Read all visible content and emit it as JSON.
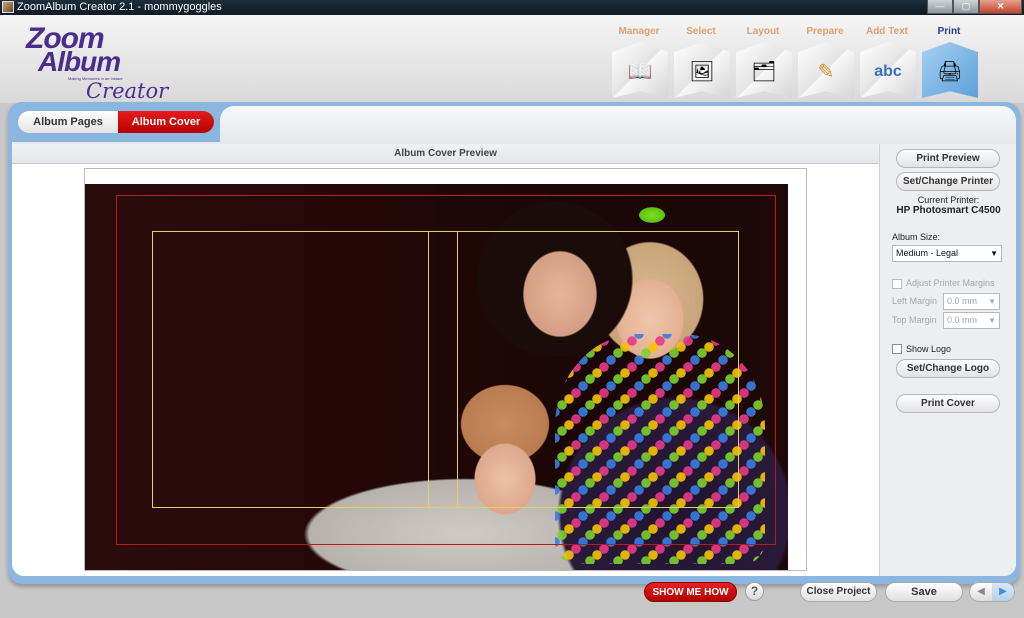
{
  "window": {
    "title": "ZoomAlbum Creator 2.1 - mommygoggles",
    "controls": {
      "minimize": "—",
      "maximize": "▢",
      "close": "✕"
    }
  },
  "logo": {
    "line1": "Zoom",
    "line2": "Album",
    "tagline": "Making Memories in an Instant",
    "line3": "Creator"
  },
  "steps": [
    {
      "label": "Manager",
      "icon": "photo-album-icon",
      "glyph": "📖"
    },
    {
      "label": "Select",
      "icon": "photos-icon",
      "glyph": "🖼"
    },
    {
      "label": "Layout",
      "icon": "layout-icon",
      "glyph": "🗂"
    },
    {
      "label": "Prepare",
      "icon": "crop-pen-icon",
      "glyph": "✎"
    },
    {
      "label": "Add Text",
      "icon": "abc-text-icon",
      "glyph": "abc"
    },
    {
      "label": "Print",
      "icon": "printer-icon",
      "glyph": "🖨",
      "active": true
    }
  ],
  "tabs": {
    "pages": "Album Pages",
    "cover": "Album Cover",
    "active": "Album Cover"
  },
  "preview": {
    "header": "Album Cover Preview"
  },
  "sidebar": {
    "print_preview": "Print Preview",
    "set_printer": "Set/Change Printer",
    "current_printer_label": "Current Printer:",
    "current_printer": "HP Photosmart C4500",
    "album_size_label": "Album Size:",
    "album_size_value": "Medium - Legal",
    "adjust_margins_label": "Adjust Printer Margins",
    "adjust_margins_checked": false,
    "left_margin_label": "Left Margin",
    "left_margin_value": "0.0 mm",
    "top_margin_label": "Top Margin",
    "top_margin_value": "0.0 mm",
    "show_logo_label": "Show Logo",
    "show_logo_checked": false,
    "set_logo": "Set/Change Logo",
    "print_cover": "Print Cover"
  },
  "bottom": {
    "show_me_how": "SHOW ME HOW",
    "help": "?",
    "close_project": "Close Project",
    "save": "Save",
    "prev": "◀",
    "next": "▶"
  },
  "colors": {
    "brand_purple": "#4a2d8c",
    "accent_red": "#d00000",
    "panel_blue": "#8ab6e0",
    "step_label": "#e0a070",
    "step_active": "#2a3d8c"
  }
}
